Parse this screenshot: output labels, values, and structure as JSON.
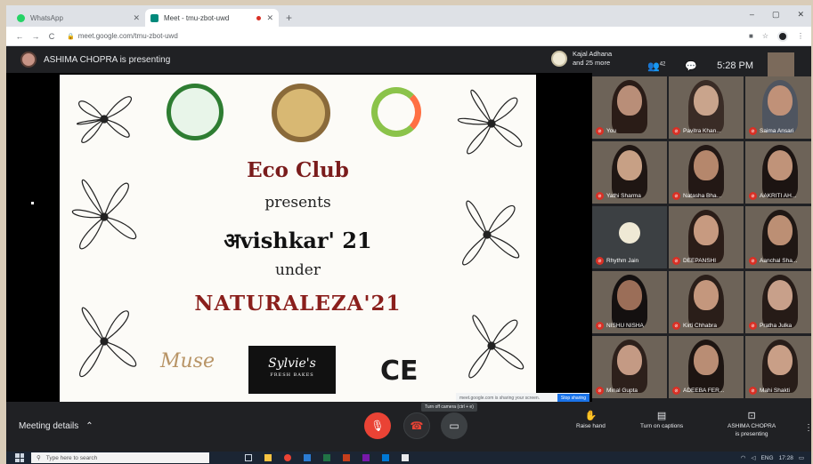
{
  "browser": {
    "tabs": [
      {
        "title": "WhatsApp",
        "favicon_color": "#25d366",
        "active": false
      },
      {
        "title": "Meet - tmu-zbot-uwd",
        "favicon_color": "#00897b",
        "active": true
      }
    ],
    "new_tab": "+",
    "window_controls": [
      "–",
      "▢",
      "✕"
    ],
    "url": "meet.google.com/tmu-zbot-uwd"
  },
  "meet_header": {
    "presenting_text": "ASHIMA CHOPRA is presenting",
    "pinned_line1": "Kajal Adhana",
    "pinned_line2": "and 25 more",
    "people_count": "42",
    "time": "5:28 PM"
  },
  "slide": {
    "club": "Eco Club",
    "presents": "presents",
    "event": "अvishkar' 21",
    "under": "under",
    "theme": "NATURALEZA'21",
    "sponsor_muse": "Muse",
    "sponsor_sylvie": "Sylvie's",
    "sponsor_sylvie_sub": "FRESH BAKES",
    "sponsor_ce": "CE"
  },
  "screen_share_bar": {
    "text": "meet.google.com is sharing your screen.",
    "stop_label": "Stop sharing"
  },
  "cam_tooltip": "Turn off camera (ctrl + e)",
  "participants": [
    {
      "name": "You",
      "kind": "video",
      "skin": "#b98e78",
      "hair": "#2a1c17"
    },
    {
      "name": "Pavitra Khan...",
      "kind": "video",
      "skin": "#c9a48c",
      "hair": "#3a2c26"
    },
    {
      "name": "Saima Ansari",
      "kind": "video",
      "skin": "#c09178",
      "hair": "#4f5560"
    },
    {
      "name": "Yathi Sharma",
      "kind": "video",
      "skin": "#c7a085",
      "hair": "#1f1613"
    },
    {
      "name": "Natasha Bha...",
      "kind": "video",
      "skin": "#b5876c",
      "hair": "#231815"
    },
    {
      "name": "AAKRITI AH...",
      "kind": "video",
      "skin": "#c09379",
      "hair": "#1c1412"
    },
    {
      "name": "Rhythm Jain",
      "kind": "avatar",
      "skin": "#efe9d5",
      "hair": "#3c4043"
    },
    {
      "name": "DEEPANSHI",
      "kind": "video",
      "skin": "#c79a80",
      "hair": "#2b1d18"
    },
    {
      "name": "Aanchal Sha...",
      "kind": "video",
      "skin": "#bc8f74",
      "hair": "#1f1714"
    },
    {
      "name": "NISHU NISHA",
      "kind": "video",
      "skin": "#9b6e58",
      "hair": "#141010"
    },
    {
      "name": "Kirti Chhabra",
      "kind": "video",
      "skin": "#c4977d",
      "hair": "#2a1e19"
    },
    {
      "name": "Pratha Julka",
      "kind": "video",
      "skin": "#c8a08a",
      "hair": "#261b17"
    },
    {
      "name": "Minal Gupta",
      "kind": "video",
      "skin": "#c49a84",
      "hair": "#2d201b"
    },
    {
      "name": "ADEEBA FER...",
      "kind": "video",
      "skin": "#b98d74",
      "hair": "#1d1512"
    },
    {
      "name": "Mahi Shakti",
      "kind": "video",
      "skin": "#c99f87",
      "hair": "#281d19"
    }
  ],
  "controls": {
    "meeting_details": "Meeting details",
    "raise_hand": "Raise hand",
    "captions": "Turn on captions",
    "presenting_line1": "ASHIMA CHOPRA",
    "presenting_line2": "is presenting"
  },
  "taskbar": {
    "search_placeholder": "Type here to search",
    "time": "17:28",
    "lang": "ENG"
  },
  "colors": {
    "meet_bg": "#202124",
    "mute_red": "#d93025",
    "slide_title": "#7a1c1c"
  }
}
